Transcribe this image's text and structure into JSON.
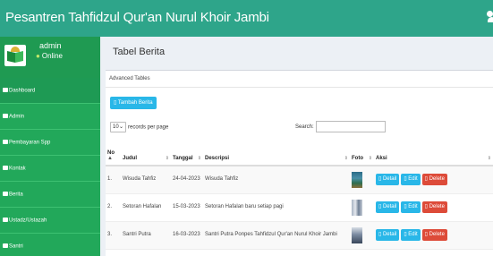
{
  "header": {
    "title": "Pesantren Tahfidzul Qur'an Nurul Khoir Jambi"
  },
  "user": {
    "name": "admin",
    "status": "Online"
  },
  "sidebar": {
    "items": [
      {
        "label": "Dashboard"
      },
      {
        "label": "Admin"
      },
      {
        "label": "Pembayaran Spp"
      },
      {
        "label": "Kontak"
      },
      {
        "label": "Berita"
      },
      {
        "label": "Ustadz/Ustazah"
      },
      {
        "label": "Santri"
      }
    ]
  },
  "page": {
    "title": "Tabel Berita"
  },
  "box": {
    "title": "Advanced Tables",
    "add_button": "Tambah Berita"
  },
  "table_controls": {
    "length_value": "10",
    "length_suffix": "records per page",
    "search_label": "Search:"
  },
  "table": {
    "headers": [
      "No",
      "Judul",
      "Tanggal",
      "Descripsi",
      "Foto",
      "Aksi"
    ],
    "rows": [
      {
        "no": "1.",
        "judul": "Wisuda Tahfiz",
        "tanggal": "24-04-2023",
        "descripsi": "Wisuda Tahfiz"
      },
      {
        "no": "2.",
        "judul": "Setoran Hafalan",
        "tanggal": "15-03-2023",
        "descripsi": "Setoran Hafalan baru setiap pagi"
      },
      {
        "no": "3.",
        "judul": "Santri Putra",
        "tanggal": "16-03-2023",
        "descripsi": "Santri Putra Ponpes Tahfidzul Qur'an Nurul Khoir Jambi"
      }
    ],
    "actions": {
      "detail": "Detail",
      "edit": "Edit",
      "delete": "Delete"
    }
  },
  "colors": {
    "header": "#2ea58a",
    "sidebar": "#22a85a",
    "info": "#29b7e8",
    "danger": "#dd4b39"
  },
  "icons": {
    "user": "user-icon",
    "menu": "menu-icon",
    "sort": "sort-icon",
    "thumbnail": "photo-thumbnail"
  }
}
